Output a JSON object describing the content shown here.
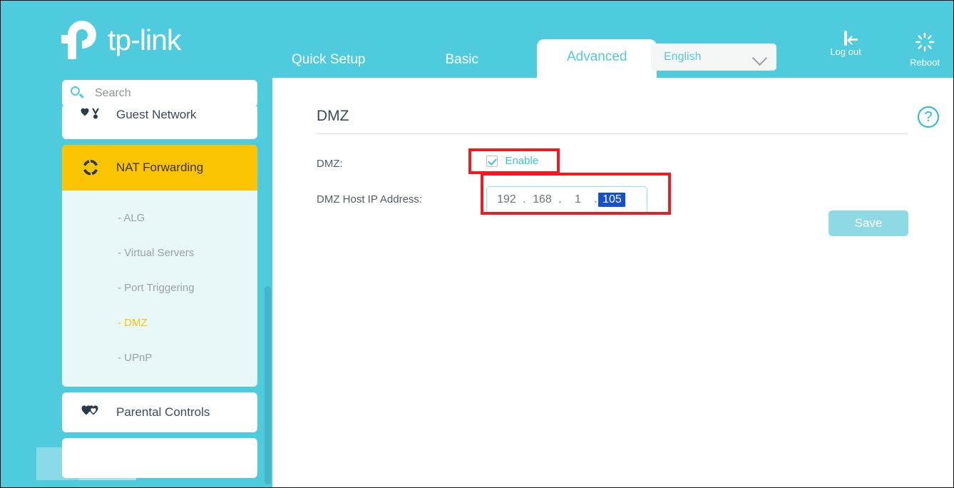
{
  "brand": {
    "name": "tp-link",
    "logo_icon": "tplink-logo-icon"
  },
  "header": {
    "tabs": [
      {
        "label": "Quick Setup",
        "active": false
      },
      {
        "label": "Basic",
        "active": false
      },
      {
        "label": "Advanced",
        "active": true
      }
    ],
    "language": {
      "selected": "English",
      "chevron_icon": "chevron-down-icon"
    },
    "actions": [
      {
        "label": "Log out",
        "icon": "logout-icon"
      },
      {
        "label": "Reboot",
        "icon": "reboot-icon"
      }
    ]
  },
  "sidebar": {
    "search": {
      "placeholder": "Search",
      "icon": "search-icon"
    },
    "items": [
      {
        "label": "Guest Network",
        "icon": "guest-network-icon",
        "active": false,
        "clipped": true
      },
      {
        "label": "NAT Forwarding",
        "icon": "nat-forwarding-icon",
        "active": true
      },
      {
        "label": "Parental Controls",
        "icon": "parental-controls-icon",
        "active": false
      }
    ],
    "submenu": [
      {
        "label": "- ALG",
        "active": false
      },
      {
        "label": "- Virtual Servers",
        "active": false
      },
      {
        "label": "- Port Triggering",
        "active": false
      },
      {
        "label": "- DMZ",
        "active": true
      },
      {
        "label": "- UPnP",
        "active": false
      }
    ],
    "scrollbar": "vertical-scrollbar"
  },
  "main": {
    "title": "DMZ",
    "help_icon": "help-question-icon",
    "fields": {
      "dmz": {
        "label": "DMZ:",
        "checkbox_label": "Enable",
        "checked": true
      },
      "host_ip": {
        "label": "DMZ Host IP Address:",
        "octets": [
          "192",
          "168",
          "1",
          "105"
        ],
        "selected_octet_index": 3,
        "value": "192.168.1.105"
      }
    },
    "save_label": "Save"
  },
  "colors": {
    "brand_teal": "#4ecbdc",
    "accent_cyan": "#3fc0d8",
    "active_amber": "#fbc403",
    "annotation_red": "#ed1c24",
    "selection_blue": "#1551c8",
    "save_button": "#8ed9e4"
  }
}
